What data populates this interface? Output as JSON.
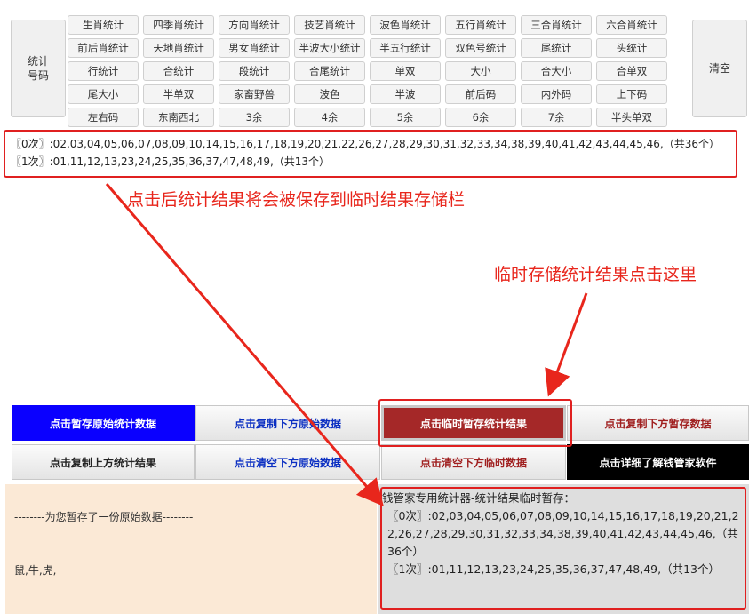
{
  "panel": {
    "left_button": "统计\n号码",
    "right_button": "清空",
    "grid": [
      "生肖统计",
      "四季肖统计",
      "方向肖统计",
      "技艺肖统计",
      "波色肖统计",
      "五行肖统计",
      "三合肖统计",
      "六合肖统计",
      "前后肖统计",
      "天地肖统计",
      "男女肖统计",
      "半波大小统计",
      "半五行统计",
      "双色号统计",
      "尾统计",
      "头统计",
      "行统计",
      "合统计",
      "段统计",
      "合尾统计",
      "单双",
      "大小",
      "合大小",
      "合单双",
      "尾大小",
      "半单双",
      "家畜野兽",
      "波色",
      "半波",
      "前后码",
      "内外码",
      "上下码",
      "左右码",
      "东南西北",
      "3余",
      "4余",
      "5余",
      "6余",
      "7余",
      "半头单双"
    ]
  },
  "result": {
    "line1": "〖0次〗:02,03,04,05,06,07,08,09,10,14,15,16,17,18,19,20,21,22,26,27,28,29,30,31,32,33,34,38,39,40,41,42,43,44,45,46,（共36个）",
    "line2": "〖1次〗:01,11,12,13,23,24,25,35,36,37,47,48,49,（共13个）"
  },
  "annotations": {
    "saved_note": "点击后统计结果将会被保存到临时结果存储栏",
    "click_here_note": "临时存储统计结果点击这里"
  },
  "buttons": {
    "row1": [
      "点击暂存原始统计数据",
      "点击复制下方原始数据",
      "点击临时暂存统计结果",
      "点击复制下方暂存数据"
    ],
    "row2": [
      "点击复制上方统计结果",
      "点击清空下方原始数据",
      "点击清空下方临时数据",
      "点击详细了解钱管家软件"
    ]
  },
  "original_area": {
    "line1": "--------为您暂存了一份原始数据--------",
    "line2": "鼠,牛,虎,"
  },
  "temp_area": {
    "title": "钱管家专用统计器-统计结果临时暂存：",
    "line1": "〖0次〗:02,03,04,05,06,07,08,09,10,14,15,16,17,18,19,20,21,22,26,27,28,29,30,31,32,33,34,38,39,40,41,42,43,44,45,46,（共36个）",
    "line2": "〖1次〗:01,11,12,13,23,24,25,35,36,37,47,48,49,（共13个）"
  },
  "colors": {
    "accent_red": "#e02020",
    "blue_button": "#0a00ff",
    "red_button": "#a52828"
  }
}
